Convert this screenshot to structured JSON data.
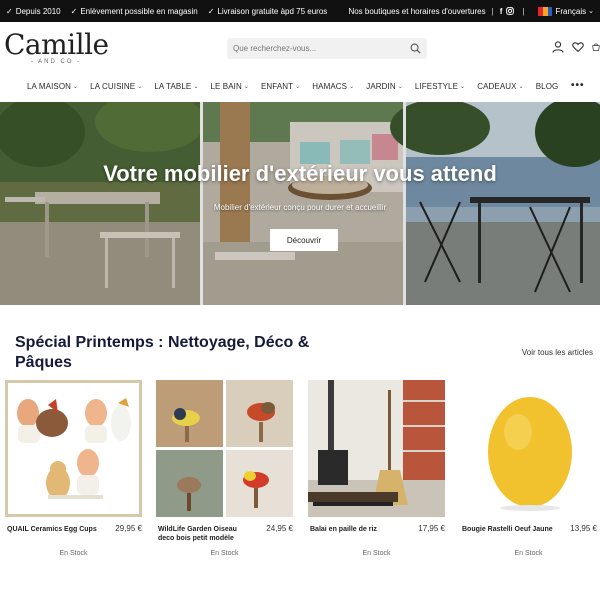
{
  "topbar": {
    "features": [
      "Depuis 2010",
      "Enlèvement possible en magasin",
      "Livraison gratuite àpd 75 euros"
    ],
    "stores_link": "Nos boutiques et horaires d'ouvertures",
    "language": "Français",
    "flag_colors": [
      "#e4252b",
      "#f5a623",
      "#2a5ebd"
    ]
  },
  "logo": {
    "main": "Camille",
    "sub": "- AND CO -"
  },
  "search": {
    "placeholder": "Que recherchez-vous..."
  },
  "nav": {
    "items": [
      "LA MAISON",
      "LA CUISINE",
      "LA TABLE",
      "LE BAIN",
      "ENFANT",
      "HAMACS",
      "JARDIN",
      "LIFESTYLE",
      "CADEAUX",
      "BLOG"
    ],
    "more": "•••"
  },
  "hero": {
    "title": "Votre mobilier d'extérieur vous attend",
    "subtitle": "Mobilier d'extérieur conçu pour durer et accueillir",
    "button": "Découvrir"
  },
  "section": {
    "title": "Spécial Printemps : Nettoyage, Déco & Pâques",
    "see_all": "Voir tous les articles"
  },
  "products": [
    {
      "name": "QUAIL Ceramics Egg Cups",
      "price": "29,95 €",
      "stock": "En Stock"
    },
    {
      "name": "WildLife Garden Oiseau deco bois petit modèle",
      "price": "24,95 €",
      "stock": "En Stock"
    },
    {
      "name": "Balai en paille de riz",
      "price": "17,95 €",
      "stock": "En Stock"
    },
    {
      "name": "Bougie Rastelli Oeuf Jaune",
      "price": "13,95 €",
      "stock": "En Stock"
    }
  ],
  "colors": {
    "accent_title": "#151a3a",
    "topbar_bg": "#111111"
  }
}
